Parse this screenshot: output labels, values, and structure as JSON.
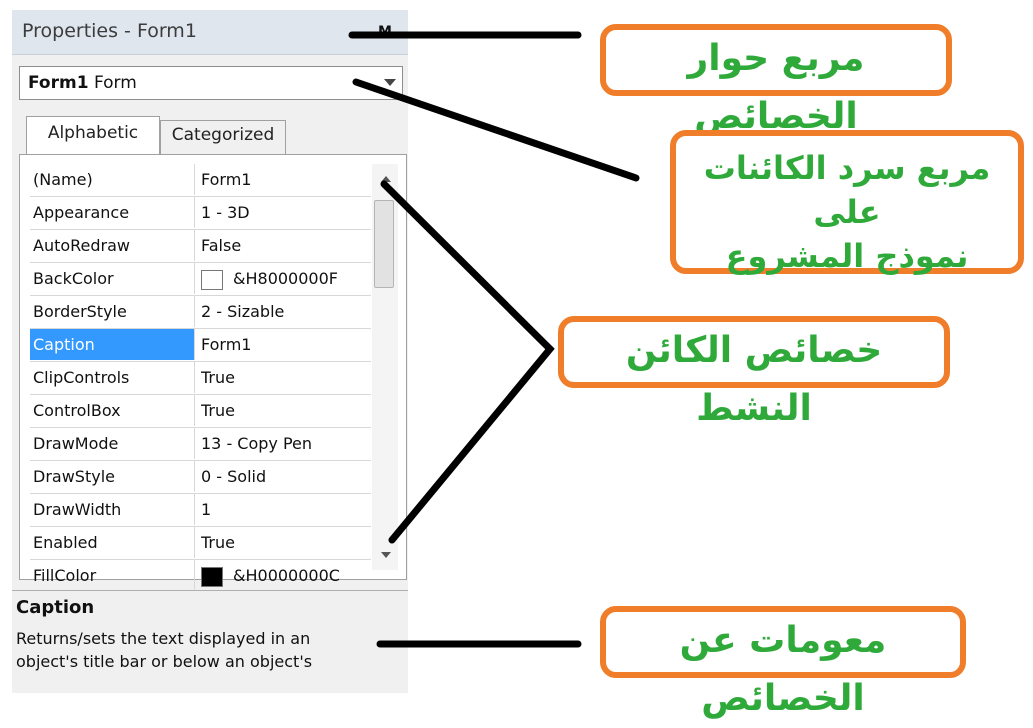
{
  "window": {
    "title": "Properties - Form1",
    "close_glyph": "M"
  },
  "object_box": {
    "name": "Form1",
    "type": "Form"
  },
  "tabs": [
    {
      "label": "Alphabetic",
      "active": true
    },
    {
      "label": "Categorized",
      "active": false
    }
  ],
  "properties": [
    {
      "name": "(Name)",
      "value": "Form1"
    },
    {
      "name": "Appearance",
      "value": "1 - 3D"
    },
    {
      "name": "AutoRedraw",
      "value": "False"
    },
    {
      "name": "BackColor",
      "value": "&H8000000F",
      "swatch": "#ffffff"
    },
    {
      "name": "BorderStyle",
      "value": "2 - Sizable"
    },
    {
      "name": "Caption",
      "value": "Form1",
      "selected": true
    },
    {
      "name": "ClipControls",
      "value": "True"
    },
    {
      "name": "ControlBox",
      "value": "True"
    },
    {
      "name": "DrawMode",
      "value": "13 - Copy Pen"
    },
    {
      "name": "DrawStyle",
      "value": "0 - Solid"
    },
    {
      "name": "DrawWidth",
      "value": "1"
    },
    {
      "name": "Enabled",
      "value": "True"
    },
    {
      "name": "FillColor",
      "value": "&H0000000C",
      "swatch": "#000000"
    }
  ],
  "description": {
    "title": "Caption",
    "line1": "Returns/sets the text displayed in an",
    "line2": "object's title bar or below an object's"
  },
  "annotations": {
    "properties_window": "مربع حوار الخصائص",
    "object_list_line1": "مربع سرد الكائنات على",
    "object_list_line2": "نموذج المشروع",
    "active_object_properties": "خصائص الكائن النشط",
    "properties_info": "معومات عن الخصائص"
  },
  "colors": {
    "callout_border": "#f07d2a",
    "callout_text": "#2faa3a",
    "selection": "#3399ff"
  }
}
